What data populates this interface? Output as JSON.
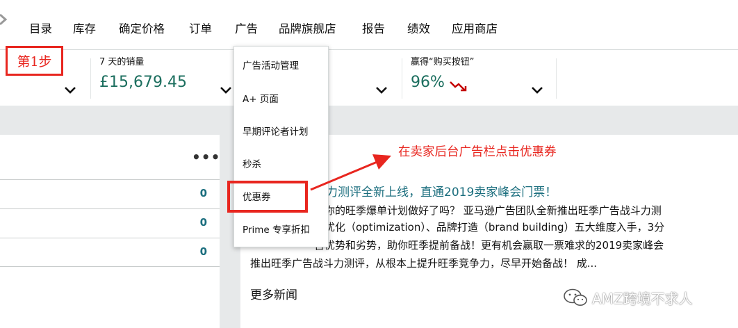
{
  "nav": {
    "items": [
      "目录",
      "库存",
      "确定价格",
      "订单",
      "广告",
      "品牌旗舰店",
      "报告",
      "绩效",
      "应用商店"
    ]
  },
  "step_label": "第1步",
  "metrics": [
    {
      "label": "7 天的销量",
      "value": "£15,679.45"
    },
    {
      "label": "赢得“购买按钮”",
      "value": "96%"
    }
  ],
  "dropdown": {
    "items": [
      "广告活动管理",
      "A+ 页面",
      "早期评论者计划",
      "秒杀",
      "优惠券",
      "Prime 专享折扣"
    ]
  },
  "left_panel": {
    "more_icon": "more-options-icon",
    "rows": [
      "0",
      "0",
      "0"
    ]
  },
  "news": {
    "title": "斗力测评全新上线，直通2019卖家峰会门票！",
    "lines": [
      "，你的旺季爆单计划做好了吗？ 亚马逊广告团队全新推出旺季广告战斗力测",
      "、优化（optimization）、品牌打造（brand building）五大维度入手，3分",
      "告优势和劣势，助你旺季提前备战！更有机会赢取一票难求的2019卖家峰会",
      "推出旺季广告战斗力测评，从根本上提升旺季竞争力，尽早开始备战！ 成..."
    ],
    "more_news": "更多新闻"
  },
  "annotation": "在卖家后台广告栏点击优惠券",
  "watermark": "AMZ跨境不求人",
  "colors": {
    "accent_red": "#e8261f",
    "metric_green": "#1b6e5e",
    "link_teal": "#1b6e7e",
    "trend_down": "#c40000"
  }
}
